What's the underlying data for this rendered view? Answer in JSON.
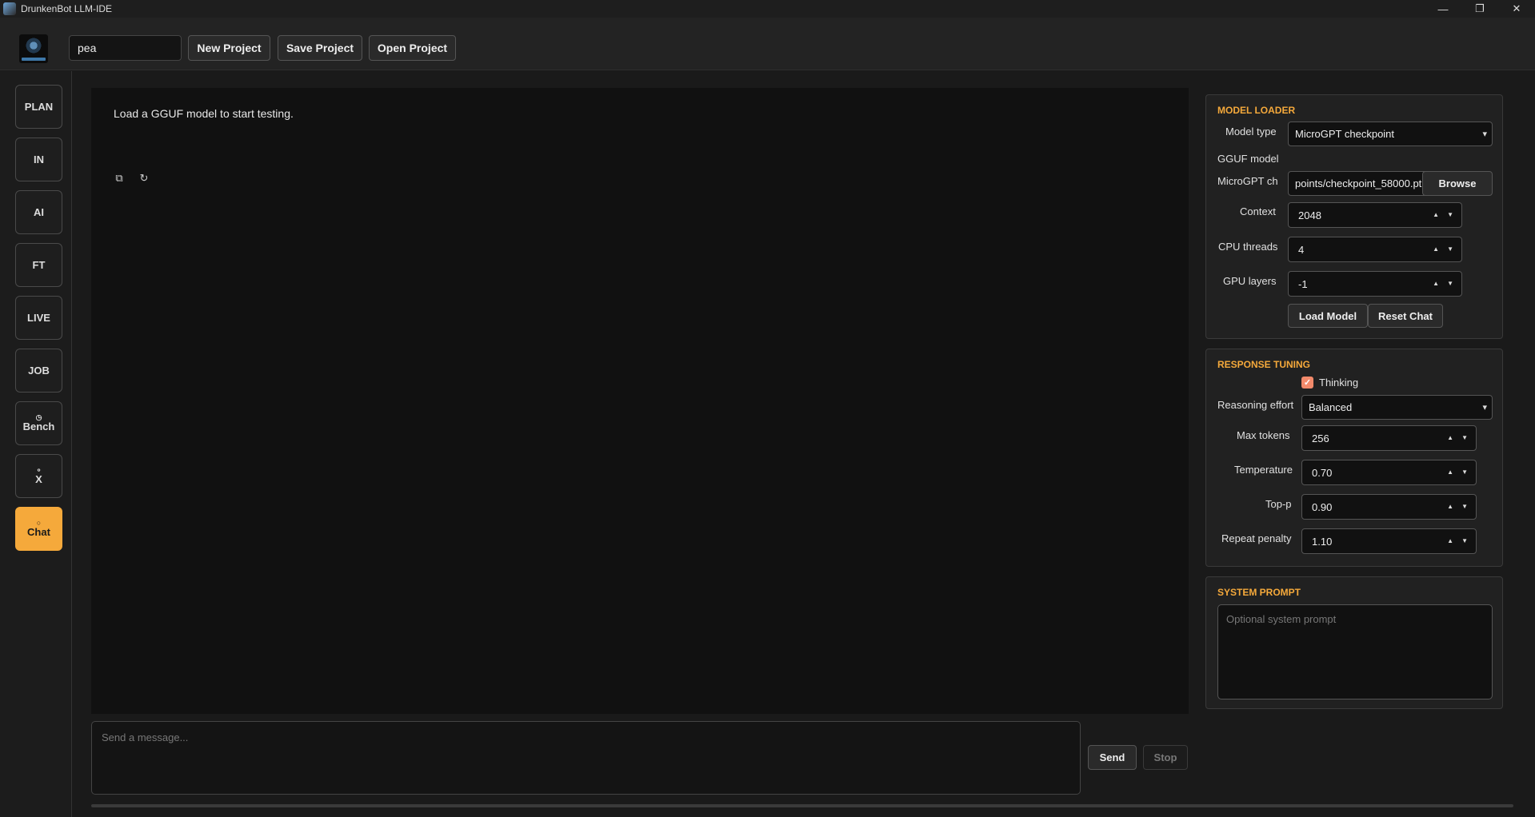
{
  "window": {
    "title": "DrunkenBot LLM-IDE",
    "minimize": "—",
    "maximize": "❐",
    "close": "✕"
  },
  "toolbar": {
    "project_name": "pea",
    "new_project": "New Project",
    "save_project": "Save Project",
    "open_project": "Open Project"
  },
  "sidebar": {
    "items": [
      {
        "label": "PLAN",
        "glyph": ""
      },
      {
        "label": "IN",
        "glyph": ""
      },
      {
        "label": "AI",
        "glyph": ""
      },
      {
        "label": "FT",
        "glyph": ""
      },
      {
        "label": "LIVE",
        "glyph": ""
      },
      {
        "label": "JOB",
        "glyph": ""
      },
      {
        "label": "Bench",
        "glyph": "◷"
      },
      {
        "label": "X",
        "glyph": "⚬"
      },
      {
        "label": "Chat",
        "glyph": "○"
      }
    ],
    "active": "Chat"
  },
  "chat": {
    "status_message": "Load a GGUF model to start testing.",
    "copy_icon": "⧉",
    "refresh_icon": "↻",
    "input_placeholder": "Send a message...",
    "send_label": "Send",
    "stop_label": "Stop"
  },
  "model_loader": {
    "title": "MODEL LOADER",
    "model_type_label": "Model type",
    "model_type_value": "MicroGPT checkpoint",
    "gguf_label": "GGUF model",
    "microgpt_label": "MicroGPT ch",
    "microgpt_path": "points/checkpoint_58000.pt",
    "browse_label": "Browse",
    "context_label": "Context",
    "context_value": "2048",
    "cpu_threads_label": "CPU threads",
    "cpu_threads_value": "4",
    "gpu_layers_label": "GPU layers",
    "gpu_layers_value": "-1",
    "load_model": "Load Model",
    "reset_chat": "Reset Chat"
  },
  "response_tuning": {
    "title": "RESPONSE TUNING",
    "thinking_label": "Thinking",
    "thinking_checked": true,
    "reasoning_label": "Reasoning effort",
    "reasoning_value": "Balanced",
    "max_tokens_label": "Max tokens",
    "max_tokens_value": "256",
    "temperature_label": "Temperature",
    "temperature_value": "0.70",
    "top_p_label": "Top-p",
    "top_p_value": "0.90",
    "repeat_penalty_label": "Repeat penalty",
    "repeat_penalty_value": "1.10"
  },
  "system_prompt": {
    "title": "SYSTEM PROMPT",
    "placeholder": "Optional system prompt"
  },
  "colors": {
    "accent": "#f5a93b",
    "checkbox": "#f28a6b",
    "background": "#1a1a1a"
  }
}
